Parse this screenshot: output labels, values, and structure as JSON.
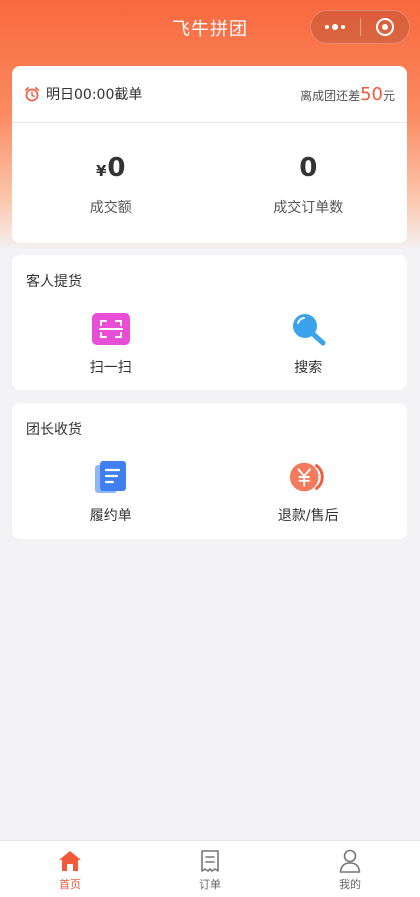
{
  "nav": {
    "title": "飞牛拼团"
  },
  "stats": {
    "deadline": "明日00:00截单",
    "remain_prefix": "离成团还差",
    "remain_amount": "50",
    "remain_unit": "元",
    "items": [
      {
        "currency": "¥",
        "value": "0",
        "label": "成交额"
      },
      {
        "currency": "",
        "value": "0",
        "label": "成交订单数"
      }
    ]
  },
  "pickup": {
    "title": "客人提货",
    "actions": [
      {
        "label": "扫一扫"
      },
      {
        "label": "搜索"
      }
    ]
  },
  "receive": {
    "title": "团长收货",
    "actions": [
      {
        "label": "履约单"
      },
      {
        "label": "退款/售后"
      }
    ]
  },
  "tabbar": {
    "tabs": [
      {
        "label": "首页"
      },
      {
        "label": "订单"
      },
      {
        "label": "我的"
      }
    ]
  },
  "colors": {
    "accent": "#f25a3a",
    "gradient_top": "#f9683e"
  }
}
